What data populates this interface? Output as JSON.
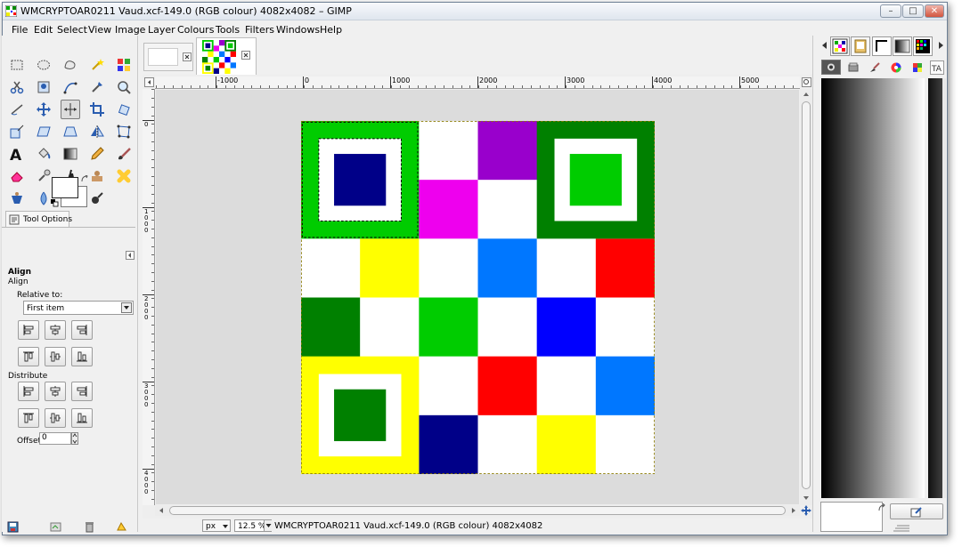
{
  "window": {
    "title": "WMCRYPTOAR0211 Vaud.xcf-149.0 (RGB colour) 4082x4082 – GIMP",
    "buttons": {
      "minimize": "–",
      "maximize": "□",
      "close": "✕"
    }
  },
  "menu": [
    "File",
    "Edit",
    "Select",
    "View",
    "Image",
    "Layer",
    "Colours",
    "Tools",
    "Filters",
    "Windows",
    "Help"
  ],
  "toolbox": {
    "tools": [
      "rect-select",
      "ellipse-select",
      "free-select",
      "fuzzy-select",
      "color-select",
      "scissors",
      "foreground-select",
      "paths",
      "color-picker",
      "zoom",
      "measure",
      "move",
      "align",
      "crop",
      "rotate",
      "scale",
      "shear",
      "perspective",
      "flip",
      "cage",
      "text",
      "bucket-fill",
      "blend",
      "pencil",
      "paintbrush",
      "eraser",
      "airbrush",
      "ink",
      "clone",
      "heal",
      "perspective-clone",
      "blur",
      "smudge",
      "dodge-burn"
    ],
    "active_tool": "align"
  },
  "tool_options": {
    "tab_label": "Tool Options",
    "heading": "Align",
    "subheading": "Align",
    "relative_label": "Relative to:",
    "relative_value": "First item",
    "distribute_label": "Distribute",
    "offset_label": "Offset:",
    "offset_value": "0"
  },
  "rulers": {
    "h_labels": [
      "-1000",
      "0",
      "1000",
      "2000",
      "3000",
      "4000",
      "5000"
    ],
    "v_labels": [
      "0",
      "1000",
      "2000",
      "3000",
      "4000"
    ]
  },
  "status": {
    "unit": "px",
    "zoom": "12.5 %",
    "text": "WMCRYPTOAR0211 Vaud.xcf-149.0 (RGB colour) 4082x4082"
  },
  "colors": {
    "green": "#00cc00",
    "dark_green": "#008000",
    "navy": "#000088",
    "purple": "#9900cc",
    "magenta": "#ee00ee",
    "yellow": "#ffff00",
    "azure": "#0077ff",
    "red": "#ff0000",
    "blue": "#0000ff",
    "white": "#ffffff"
  },
  "image_grid": [
    [
      "big",
      "big",
      "white",
      "purple",
      "big",
      "big"
    ],
    [
      "big",
      "big",
      "magenta",
      "white",
      "big",
      "big"
    ],
    [
      "white",
      "yellow",
      "white",
      "azure",
      "white",
      "red"
    ],
    [
      "dark_green",
      "white",
      "green",
      "white",
      "blue",
      "white"
    ],
    [
      "big",
      "big",
      "white",
      "red",
      "white",
      "azure"
    ],
    [
      "big",
      "big",
      "navy",
      "white",
      "yellow",
      "white"
    ]
  ],
  "finder_patterns": [
    {
      "position": "top-left",
      "outer": "green",
      "middle": "white",
      "inner": "navy"
    },
    {
      "position": "top-right",
      "outer": "dark_green",
      "middle": "white",
      "inner": "green"
    },
    {
      "position": "bottom-left",
      "outer": "yellow",
      "middle": "white",
      "inner": "dark_green"
    }
  ]
}
